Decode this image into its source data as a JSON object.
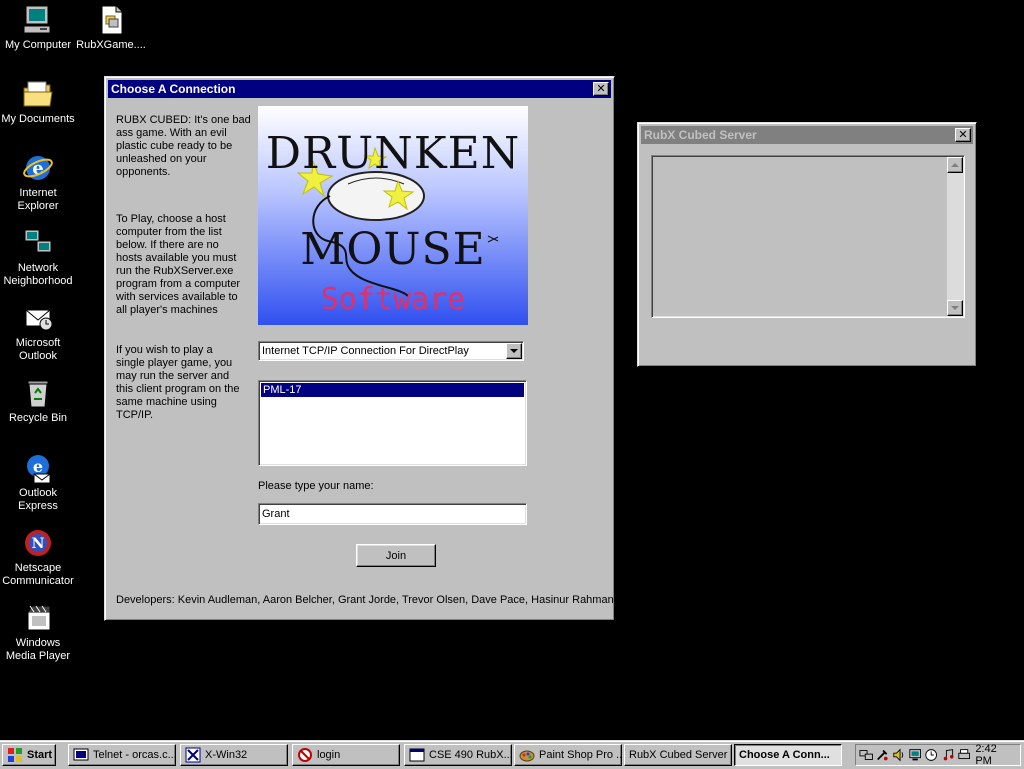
{
  "desktop": {
    "icons": [
      {
        "label": "My Computer"
      },
      {
        "label": "RubXGame...."
      },
      {
        "label": "My Documents"
      },
      {
        "label": "Internet Explorer"
      },
      {
        "label": "Network Neighborhood"
      },
      {
        "label": "Microsoft Outlook"
      },
      {
        "label": "Recycle Bin"
      },
      {
        "label": "Outlook Express"
      },
      {
        "label": "Netscape Communicator"
      },
      {
        "label": "Windows Media Player"
      }
    ]
  },
  "dialog": {
    "title": "Choose A Connection",
    "intro": "RUBX CUBED: It's one bad ass game.  With an evil plastic cube ready to be unleashed on your opponents.",
    "instructions": "To Play, choose a host computer from the list below.  If there are no hosts available you must run the RubXServer.exe program from a computer with services available to all player's machines",
    "single_player": " If you wish to play a single player game, you may run the server and this client program on the same machine using TCP/IP.",
    "logo": {
      "line1": "DRUNKEN",
      "line2": "MOUSE",
      "line3": "Software"
    },
    "connection_select": "Internet TCP/IP Connection For DirectPlay",
    "hosts": [
      "PML-17"
    ],
    "name_label": "Please type your name:",
    "name_value": "Grant",
    "join_label": "Join",
    "developers": "Developers: Kevin Audleman, Aaron Belcher, Grant Jorde, Trevor Olsen, Dave Pace, Hasinur Rahman"
  },
  "server_window": {
    "title": "RubX Cubed Server"
  },
  "taskbar": {
    "start_label": "Start",
    "buttons": [
      {
        "label": "Telnet - orcas.c..."
      },
      {
        "label": "X-Win32"
      },
      {
        "label": "login"
      },
      {
        "label": "CSE 490 RubX..."
      },
      {
        "label": "Paint Shop Pro ..."
      },
      {
        "label": "RubX Cubed Server"
      },
      {
        "label": "Choose A Conn..."
      }
    ],
    "clock": "2:42 PM"
  },
  "colors": {
    "desktop": "#000000",
    "title_active": "#000080",
    "title_inactive": "#808080",
    "face": "#c0c0c0",
    "logo_text": "#111111",
    "logo_software": "#e0306a"
  }
}
